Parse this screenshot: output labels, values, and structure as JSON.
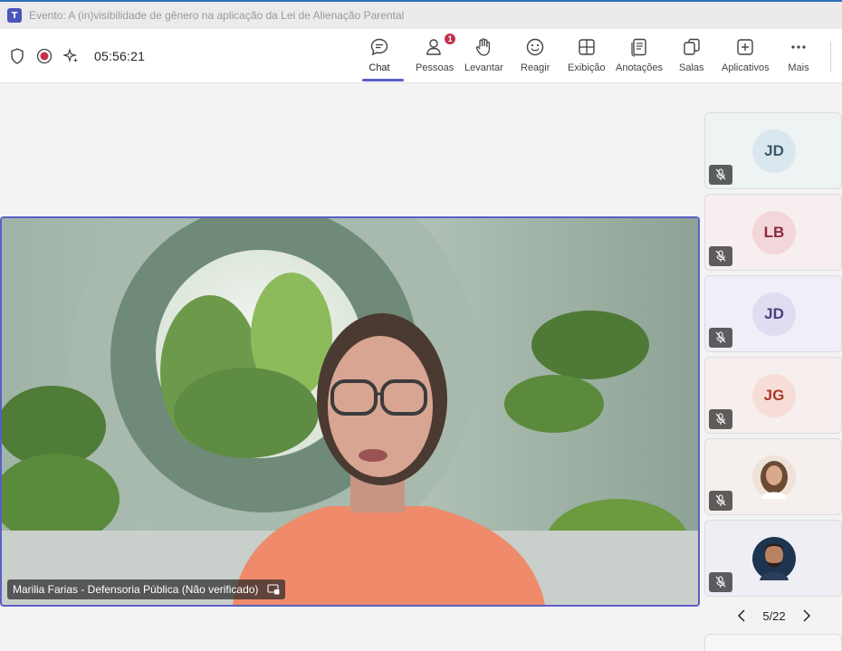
{
  "window": {
    "app_icon_letter": "T",
    "title": "Evento: A (in)visibilidade de gênero na aplicação da Lei de Alienação Parental"
  },
  "controls": {
    "timer": "05:56:21",
    "icons": [
      "shield-icon",
      "record-icon",
      "sparkle-icon"
    ],
    "record_color": "#c4314b"
  },
  "toolbar": {
    "accent": "#5b5fc7",
    "items": [
      {
        "label": "Chat",
        "icon": "chat-icon",
        "active": true
      },
      {
        "label": "Pessoas",
        "icon": "people-icon",
        "badge": "1"
      },
      {
        "label": "Levantar",
        "icon": "raise-hand-icon"
      },
      {
        "label": "Reagir",
        "icon": "react-icon"
      },
      {
        "label": "Exibição",
        "icon": "view-icon"
      },
      {
        "label": "Anotações",
        "icon": "notes-icon"
      },
      {
        "label": "Salas",
        "icon": "rooms-icon"
      },
      {
        "label": "Aplicativos",
        "icon": "apps-icon"
      },
      {
        "label": "Mais",
        "icon": "more-icon"
      }
    ]
  },
  "stage": {
    "speaker_name": "Marilia Farias - Defensoria Pública (Não verificado)",
    "icon": "screen-share-icon"
  },
  "participants": [
    {
      "initials": "JD",
      "avatar_bg": "#dbe7ee",
      "avatar_fg": "#3a5a6a",
      "tile_bg": "#eef3f3",
      "muted": true
    },
    {
      "initials": "LB",
      "avatar_bg": "#f3d6d9",
      "avatar_fg": "#8a2b3a",
      "tile_bg": "#f6eeef",
      "muted": true
    },
    {
      "initials": "JD",
      "avatar_bg": "#e1dcf1",
      "avatar_fg": "#4a3f7a",
      "tile_bg": "#f0eef6",
      "muted": true
    },
    {
      "initials": "JG",
      "avatar_bg": "#f7ddd7",
      "avatar_fg": "#a8392a",
      "tile_bg": "#f6efed",
      "muted": true
    },
    {
      "initials": "",
      "photo": "woman-photo",
      "tile_bg": "#f5efee",
      "muted": true
    },
    {
      "initials": "",
      "photo": "man-photo",
      "tile_bg": "#efeef5",
      "muted": true
    }
  ],
  "pager": {
    "text": "5/22",
    "prev_icon": "chevron-left-icon",
    "next_icon": "chevron-right-icon"
  }
}
